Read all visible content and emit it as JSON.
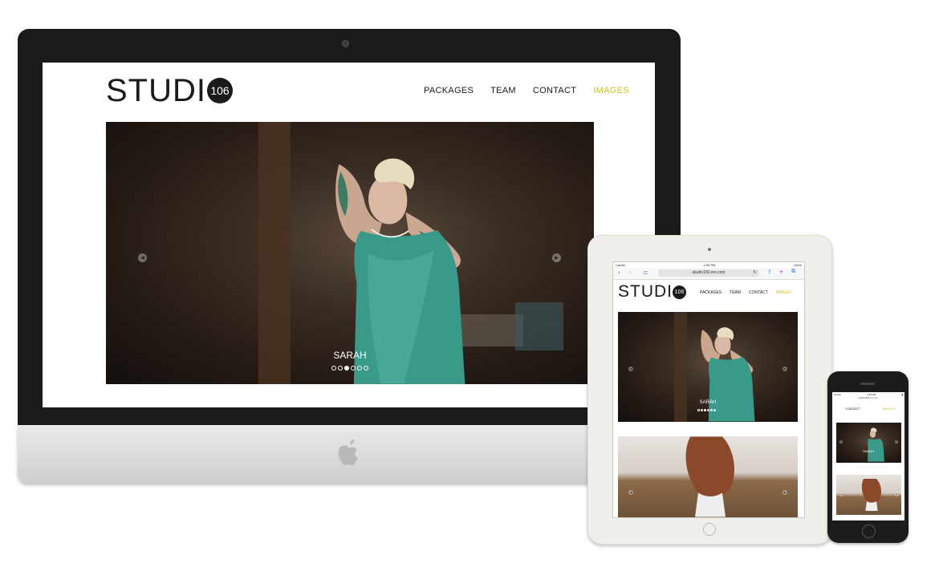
{
  "site": {
    "logo_text": "STUDI",
    "logo_badge": "106",
    "nav": [
      "PACKAGES",
      "TEAM",
      "CONTACT",
      "IMAGES"
    ],
    "active_nav": "IMAGES",
    "slide_caption": "SARAH",
    "slide_count": 6,
    "active_slide": 3,
    "prev_arrow": "◀",
    "next_arrow": "▶"
  },
  "ipad": {
    "status_left": "Carrier",
    "status_time": "1:50 PM",
    "status_right": "100%",
    "url": "studio106-mn.com"
  },
  "iphone": {
    "status_left": "Carrier",
    "status_time": "4:36 PM",
    "url": "studio106-mn.com",
    "nav": [
      "CONTACT",
      "IMAGES"
    ]
  },
  "colors": {
    "accent": "#c9c02a",
    "dark": "#1a1a1a"
  },
  "icons": [
    "camera-icon",
    "apple-logo-icon",
    "home-button-icon",
    "left-arrow-icon",
    "right-arrow-icon",
    "reload-icon",
    "share-icon",
    "add-icon",
    "tabs-icon",
    "bookmarks-icon"
  ]
}
